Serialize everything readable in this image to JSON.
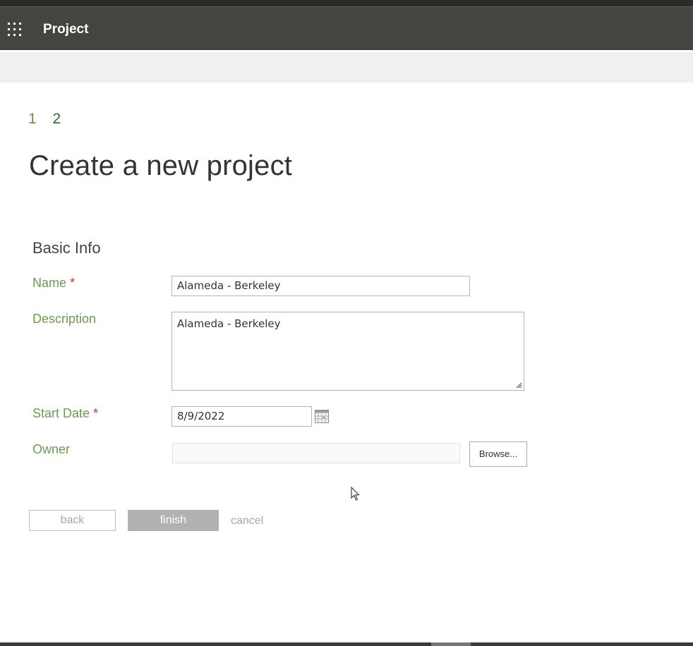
{
  "app": {
    "title": "Project"
  },
  "steps": [
    "1",
    "2"
  ],
  "page_title": "Create a new project",
  "section": {
    "title": "Basic Info"
  },
  "fields": {
    "name": {
      "label": "Name",
      "required_mark": "*",
      "value": "Alameda - Berkeley"
    },
    "description": {
      "label": "Description",
      "value": "Alameda - Berkeley"
    },
    "start_date": {
      "label": "Start Date",
      "required_mark": "*",
      "value": "8/9/2022"
    },
    "owner": {
      "label": "Owner",
      "value": "",
      "browse_label": "Browse..."
    }
  },
  "actions": {
    "back": "back",
    "finish": "finish",
    "cancel": "cancel"
  },
  "icons": {
    "app_launcher": "waffle-icon",
    "calendar": "calendar-icon",
    "cursor": "mouse-pointer-icon"
  },
  "colors": {
    "suite_bar": "#444441",
    "label_green": "#6b9b51",
    "required_red": "#c0392b",
    "disabled_button": "#b1b1b1"
  }
}
